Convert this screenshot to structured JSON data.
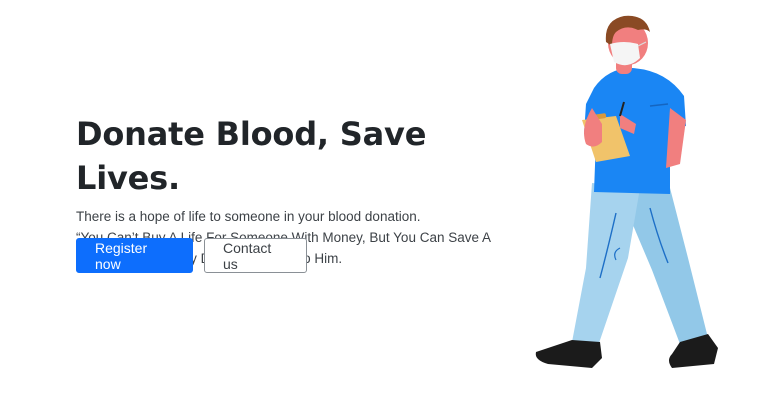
{
  "hero": {
    "title": "Donate Blood, Save Lives.",
    "line1": "There is a hope of life to someone in your blood donation.",
    "line2": "“You Can’t Buy A Life For Someone With Money, But You Can Save A",
    "line3": "Life Of Someone By Donating Blood To Him."
  },
  "buttons": {
    "register_label": "Register now",
    "contact_label": "Contact us"
  },
  "colors": {
    "primary": "#0d6efd",
    "shirt": "#1a86f4",
    "pants": "#a6d3ee",
    "skin": "#f17f7f",
    "hair": "#8a4a24",
    "clipboard": "#f1c36a"
  },
  "illustration": {
    "icon": "blood-donor-volunteer-illustration"
  }
}
